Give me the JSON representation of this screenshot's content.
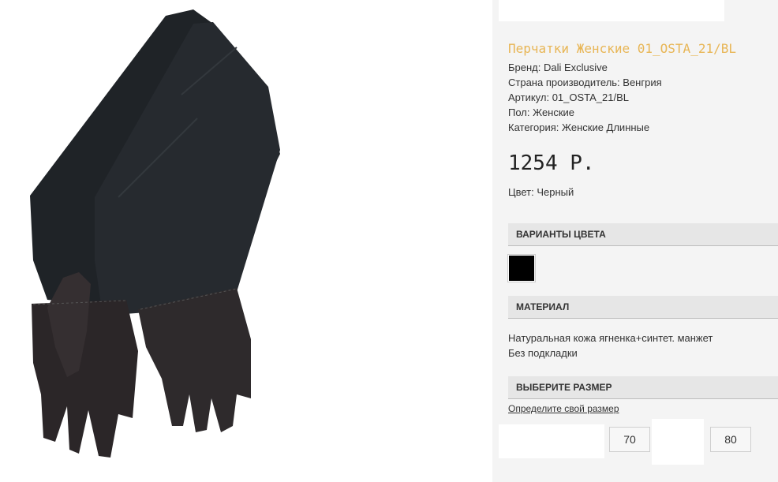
{
  "product": {
    "title": "Перчатки Женские 01_OSTA_21/BL",
    "brand": "Бренд: Dali Exclusive",
    "country": "Страна производитель: Венгрия",
    "article": "Артикул: 01_OSTA_21/BL",
    "gender": "Пол: Женские",
    "category": "Категория: Женские Длинные",
    "price": "1254 Р.",
    "color": "Цвет: Черный"
  },
  "sections": {
    "color_variants": "ВАРИАНТЫ ЦВЕТА",
    "material": "МАТЕРИАЛ",
    "choose_size": "ВЫБЕРИТЕ РАЗМЕР"
  },
  "color_swatch": {
    "color": "#000000"
  },
  "material": {
    "line1": "Натуральная кожа ягненка+синтет. манжет",
    "line2": "Без подкладки"
  },
  "size": {
    "link": "Определите свой размер",
    "options": [
      "70",
      "80"
    ]
  },
  "colors": {
    "title": "#e8b656",
    "sidebar_bg": "#f4f4f4",
    "section_bg": "#e6e6e6"
  }
}
